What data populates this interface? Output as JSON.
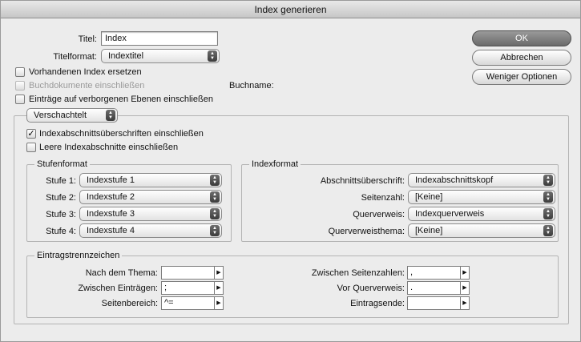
{
  "window": {
    "title": "Index generieren"
  },
  "form": {
    "title_label": "Titel:",
    "title_value": "Index",
    "titleformat_label": "Titelformat:",
    "titleformat_value": "Indextitel"
  },
  "buttons": {
    "ok": "OK",
    "cancel": "Abbrechen",
    "fewer_options": "Weniger Optionen"
  },
  "options": {
    "replace_existing": {
      "label": "Vorhandenen Index ersetzen",
      "checked": false
    },
    "include_book": {
      "label": "Buchdokumente einschließen",
      "checked": false,
      "disabled": true
    },
    "book_name_label": "Buchname:",
    "include_hidden": {
      "label": "Einträge auf verborgenen Ebenen einschließen",
      "checked": false
    }
  },
  "nesting": {
    "value": "Verschachtelt"
  },
  "section_options": {
    "include_headings": {
      "label": "Indexabschnittsüberschriften einschließen",
      "checked": true
    },
    "include_empty": {
      "label": "Leere Indexabschnitte einschließen",
      "checked": false
    }
  },
  "level_style": {
    "title": "Stufenformat",
    "levels": [
      {
        "label": "Stufe 1:",
        "value": "Indexstufe 1"
      },
      {
        "label": "Stufe 2:",
        "value": "Indexstufe 2"
      },
      {
        "label": "Stufe 3:",
        "value": "Indexstufe 3"
      },
      {
        "label": "Stufe 4:",
        "value": "Indexstufe 4"
      }
    ]
  },
  "index_format": {
    "title": "Indexformat",
    "rows": [
      {
        "label": "Abschnittsüberschrift:",
        "value": "Indexabschnittskopf"
      },
      {
        "label": "Seitenzahl:",
        "value": "[Keine]"
      },
      {
        "label": "Querverweis:",
        "value": "Indexquerverweis"
      },
      {
        "label": "Querverweisthema:",
        "value": "[Keine]"
      }
    ]
  },
  "separators": {
    "title": "Eintragstrennzeichen",
    "left": [
      {
        "label": "Nach dem Thema:",
        "value": ""
      },
      {
        "label": "Zwischen Einträgen:",
        "value": ";"
      },
      {
        "label": "Seitenbereich:",
        "value": "^="
      }
    ],
    "right": [
      {
        "label": "Zwischen Seitenzahlen:",
        "value": ","
      },
      {
        "label": "Vor Querverweis:",
        "value": "."
      },
      {
        "label": "Eintragsende:",
        "value": ""
      }
    ]
  }
}
